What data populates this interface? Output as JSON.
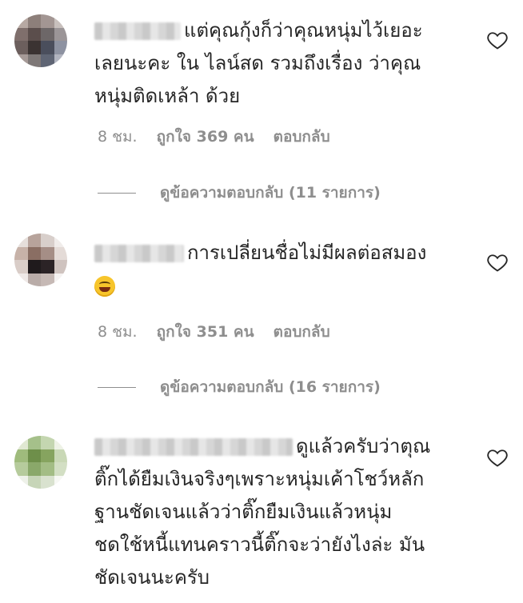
{
  "comments": [
    {
      "text_line1": "แต่คุณกุ้งก็ว่าคุณหนุ่มไว้เยอะ",
      "text_rest": [
        "เลยนะคะ ใน ไลน์สด รวมถึงเรื่อง ว่าคุณ",
        "หนุ่มติดเหล้า ด้วย"
      ],
      "time": "8 ชม.",
      "likes": "ถูกใจ 369 คน",
      "reply": "ตอบกลับ",
      "view_replies": "ดูข้อความตอบกลับ (11 รายการ)"
    },
    {
      "text_line1": "การเปลี่ยนชื่อไม่มีผลต่อสมอง",
      "text_rest": [],
      "time": "8 ชม.",
      "likes": "ถูกใจ 351 คน",
      "reply": "ตอบกลับ",
      "view_replies": "ดูข้อความตอบกลับ (16 รายการ)"
    },
    {
      "text_line1": "ดูแล้วครับว่าตุณ",
      "text_rest": [
        "ติ๊กได้ยืมเงินจริงๆเพราะหนุ่มเค้าโชว์หลัก",
        "ฐานชัดเจนแล้วว่าติ๊กยืมเงินแล้วหนุ่ม",
        "ชดใช้หนี้แทนคราวนี้ติ๊กจะว่ายังไงล่ะ มัน",
        "ชัดเจนนะครับ"
      ]
    }
  ],
  "colors": {
    "text": "#262626",
    "muted": "#8e8e8e"
  },
  "icons": {
    "like": "heart-outline-icon",
    "emoji": "grinning-squinting-face-emoji"
  }
}
